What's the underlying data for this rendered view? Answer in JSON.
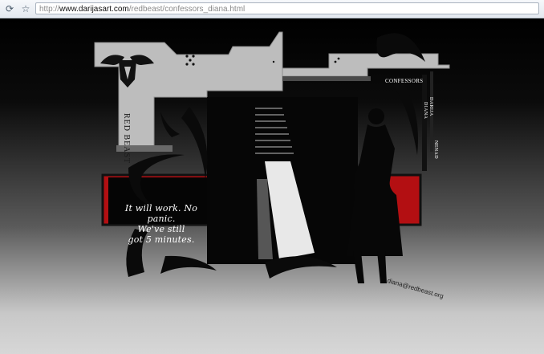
{
  "browser": {
    "url_scheme": "http://",
    "url_host": "www.darijasart.com",
    "url_path": "/redbeast/confessors_diana.html"
  },
  "page": {
    "brand_title": "RED BEAST",
    "nav": {
      "confessors": "CONFESSORS",
      "diana": "DIANA",
      "darija": "DARIJA",
      "nenad": "NENAD"
    },
    "quote_lines": [
      "It will work. No panic.",
      "We've still",
      "got 5 minutes."
    ],
    "email": "diana@redbeast.org",
    "colors": {
      "accent_red": "#b30f12"
    }
  }
}
